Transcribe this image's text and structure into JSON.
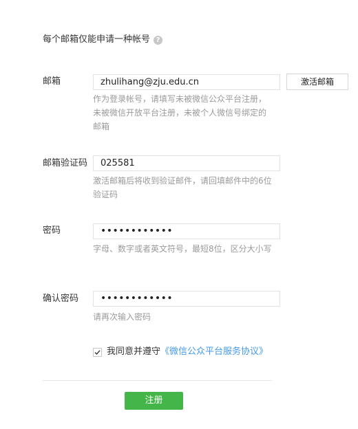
{
  "notice": {
    "text": "每个邮箱仅能申请一种帐号",
    "help_icon": "?"
  },
  "email": {
    "label": "邮箱",
    "value": "zhulihang@zju.edu.cn",
    "activate_button": "激活邮箱",
    "hint": "作为登录帐号，请填写未被微信公众平台注册，未被微信开放平台注册，未被个人微信号绑定的邮箱"
  },
  "verify_code": {
    "label": "邮箱验证码",
    "value": "025581",
    "hint": "激活邮箱后将收到验证邮件，请回填邮件中的6位验证码"
  },
  "password": {
    "label": "密码",
    "value": "••••••••••••",
    "hint": "字母、数字或者英文符号，最短8位，区分大小写"
  },
  "confirm_password": {
    "label": "确认密码",
    "value": "••••••••••••",
    "hint": "请再次输入密码"
  },
  "agreement": {
    "checked": true,
    "text": "我同意并遵守",
    "link": "《微信公众平台服务协议》"
  },
  "submit": {
    "label": "注册"
  },
  "colors": {
    "primary_green": "#44b549",
    "link_blue": "#459ae9",
    "hint_gray": "#9a9a9a"
  }
}
